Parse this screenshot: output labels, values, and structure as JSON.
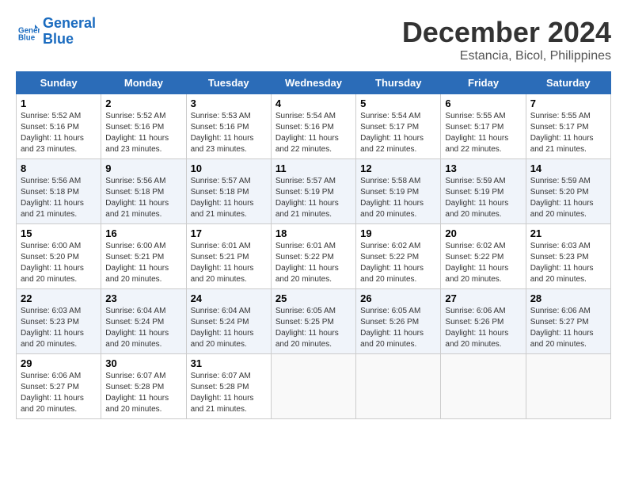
{
  "logo": {
    "line1": "General",
    "line2": "Blue"
  },
  "title": "December 2024",
  "subtitle": "Estancia, Bicol, Philippines",
  "days_of_week": [
    "Sunday",
    "Monday",
    "Tuesday",
    "Wednesday",
    "Thursday",
    "Friday",
    "Saturday"
  ],
  "weeks": [
    [
      {
        "num": "1",
        "rise": "5:52 AM",
        "set": "5:16 PM",
        "daylight": "11 hours and 23 minutes."
      },
      {
        "num": "2",
        "rise": "5:52 AM",
        "set": "5:16 PM",
        "daylight": "11 hours and 23 minutes."
      },
      {
        "num": "3",
        "rise": "5:53 AM",
        "set": "5:16 PM",
        "daylight": "11 hours and 23 minutes."
      },
      {
        "num": "4",
        "rise": "5:54 AM",
        "set": "5:16 PM",
        "daylight": "11 hours and 22 minutes."
      },
      {
        "num": "5",
        "rise": "5:54 AM",
        "set": "5:17 PM",
        "daylight": "11 hours and 22 minutes."
      },
      {
        "num": "6",
        "rise": "5:55 AM",
        "set": "5:17 PM",
        "daylight": "11 hours and 22 minutes."
      },
      {
        "num": "7",
        "rise": "5:55 AM",
        "set": "5:17 PM",
        "daylight": "11 hours and 21 minutes."
      }
    ],
    [
      {
        "num": "8",
        "rise": "5:56 AM",
        "set": "5:18 PM",
        "daylight": "11 hours and 21 minutes."
      },
      {
        "num": "9",
        "rise": "5:56 AM",
        "set": "5:18 PM",
        "daylight": "11 hours and 21 minutes."
      },
      {
        "num": "10",
        "rise": "5:57 AM",
        "set": "5:18 PM",
        "daylight": "11 hours and 21 minutes."
      },
      {
        "num": "11",
        "rise": "5:57 AM",
        "set": "5:19 PM",
        "daylight": "11 hours and 21 minutes."
      },
      {
        "num": "12",
        "rise": "5:58 AM",
        "set": "5:19 PM",
        "daylight": "11 hours and 20 minutes."
      },
      {
        "num": "13",
        "rise": "5:59 AM",
        "set": "5:19 PM",
        "daylight": "11 hours and 20 minutes."
      },
      {
        "num": "14",
        "rise": "5:59 AM",
        "set": "5:20 PM",
        "daylight": "11 hours and 20 minutes."
      }
    ],
    [
      {
        "num": "15",
        "rise": "6:00 AM",
        "set": "5:20 PM",
        "daylight": "11 hours and 20 minutes."
      },
      {
        "num": "16",
        "rise": "6:00 AM",
        "set": "5:21 PM",
        "daylight": "11 hours and 20 minutes."
      },
      {
        "num": "17",
        "rise": "6:01 AM",
        "set": "5:21 PM",
        "daylight": "11 hours and 20 minutes."
      },
      {
        "num": "18",
        "rise": "6:01 AM",
        "set": "5:22 PM",
        "daylight": "11 hours and 20 minutes."
      },
      {
        "num": "19",
        "rise": "6:02 AM",
        "set": "5:22 PM",
        "daylight": "11 hours and 20 minutes."
      },
      {
        "num": "20",
        "rise": "6:02 AM",
        "set": "5:22 PM",
        "daylight": "11 hours and 20 minutes."
      },
      {
        "num": "21",
        "rise": "6:03 AM",
        "set": "5:23 PM",
        "daylight": "11 hours and 20 minutes."
      }
    ],
    [
      {
        "num": "22",
        "rise": "6:03 AM",
        "set": "5:23 PM",
        "daylight": "11 hours and 20 minutes."
      },
      {
        "num": "23",
        "rise": "6:04 AM",
        "set": "5:24 PM",
        "daylight": "11 hours and 20 minutes."
      },
      {
        "num": "24",
        "rise": "6:04 AM",
        "set": "5:24 PM",
        "daylight": "11 hours and 20 minutes."
      },
      {
        "num": "25",
        "rise": "6:05 AM",
        "set": "5:25 PM",
        "daylight": "11 hours and 20 minutes."
      },
      {
        "num": "26",
        "rise": "6:05 AM",
        "set": "5:26 PM",
        "daylight": "11 hours and 20 minutes."
      },
      {
        "num": "27",
        "rise": "6:06 AM",
        "set": "5:26 PM",
        "daylight": "11 hours and 20 minutes."
      },
      {
        "num": "28",
        "rise": "6:06 AM",
        "set": "5:27 PM",
        "daylight": "11 hours and 20 minutes."
      }
    ],
    [
      {
        "num": "29",
        "rise": "6:06 AM",
        "set": "5:27 PM",
        "daylight": "11 hours and 20 minutes."
      },
      {
        "num": "30",
        "rise": "6:07 AM",
        "set": "5:28 PM",
        "daylight": "11 hours and 20 minutes."
      },
      {
        "num": "31",
        "rise": "6:07 AM",
        "set": "5:28 PM",
        "daylight": "11 hours and 21 minutes."
      },
      null,
      null,
      null,
      null
    ]
  ]
}
